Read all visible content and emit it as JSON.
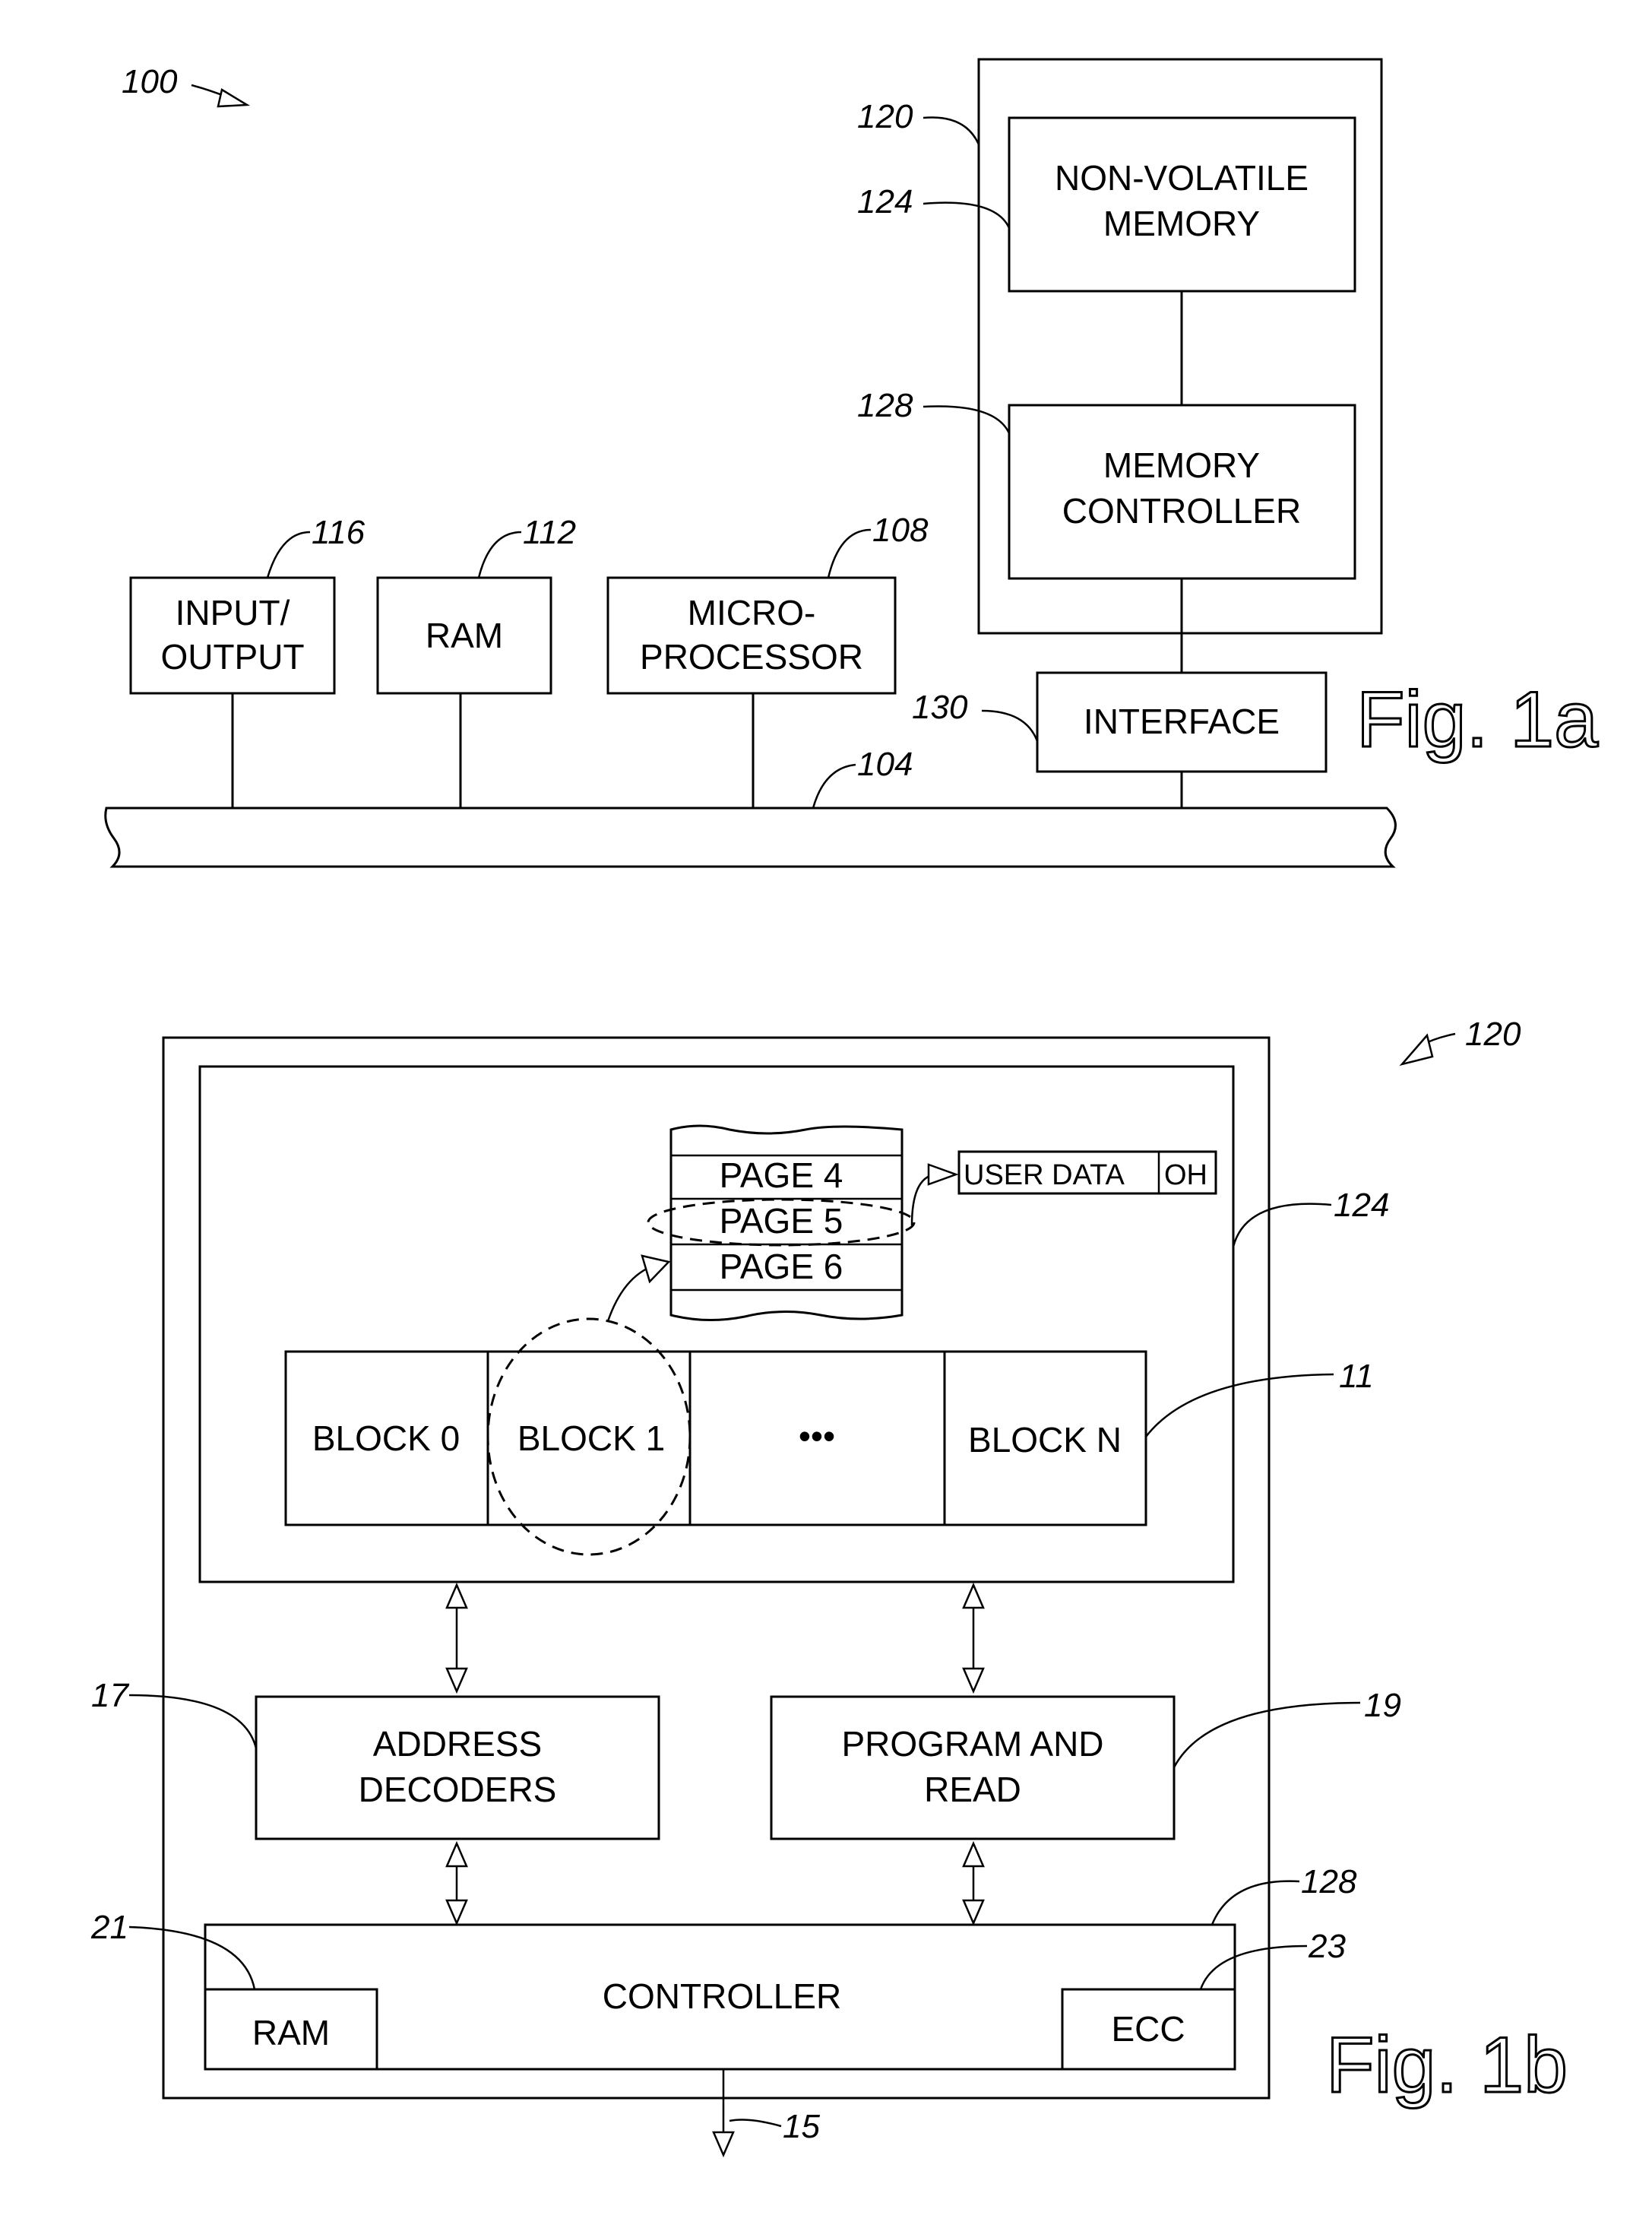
{
  "figure_1a": {
    "caption": "Fig. 1a",
    "system_ref": "100",
    "bus_ref": "104",
    "blocks": {
      "input_output": {
        "ref": "116",
        "lines": [
          "INPUT/",
          "OUTPUT"
        ]
      },
      "ram": {
        "ref": "112",
        "lines": [
          "RAM"
        ]
      },
      "microprocessor": {
        "ref": "108",
        "lines": [
          "MICRO-",
          "PROCESSOR"
        ]
      },
      "memory_system": {
        "ref": "120"
      },
      "non_volatile_memory": {
        "ref": "124",
        "lines": [
          "NON-VOLATILE",
          "MEMORY"
        ]
      },
      "memory_controller": {
        "ref": "128",
        "lines": [
          "MEMORY",
          "CONTROLLER"
        ]
      },
      "interface": {
        "ref": "130",
        "lines": [
          "INTERFACE"
        ]
      }
    }
  },
  "figure_1b": {
    "caption": "Fig. 1b",
    "system_ref": "120",
    "memory_array_ref": "124",
    "block_row_ref": "11",
    "pages": [
      "PAGE 4",
      "PAGE 5",
      "PAGE 6"
    ],
    "page_format": {
      "user_data": "USER  DATA",
      "overhead": "OH"
    },
    "memory_blocks": [
      "BLOCK 0",
      "BLOCK 1",
      "•••",
      "BLOCK N"
    ],
    "address_decoders": {
      "ref": "17",
      "lines": [
        "ADDRESS",
        "DECODERS"
      ]
    },
    "program_and_read": {
      "ref": "19",
      "lines": [
        "PROGRAM AND",
        "READ"
      ]
    },
    "controller": {
      "ref": "128",
      "label": "CONTROLLER"
    },
    "controller_ram": {
      "ref": "21",
      "label": "RAM"
    },
    "controller_ecc": {
      "ref": "23",
      "label": "ECC"
    },
    "output_ref": "15"
  }
}
